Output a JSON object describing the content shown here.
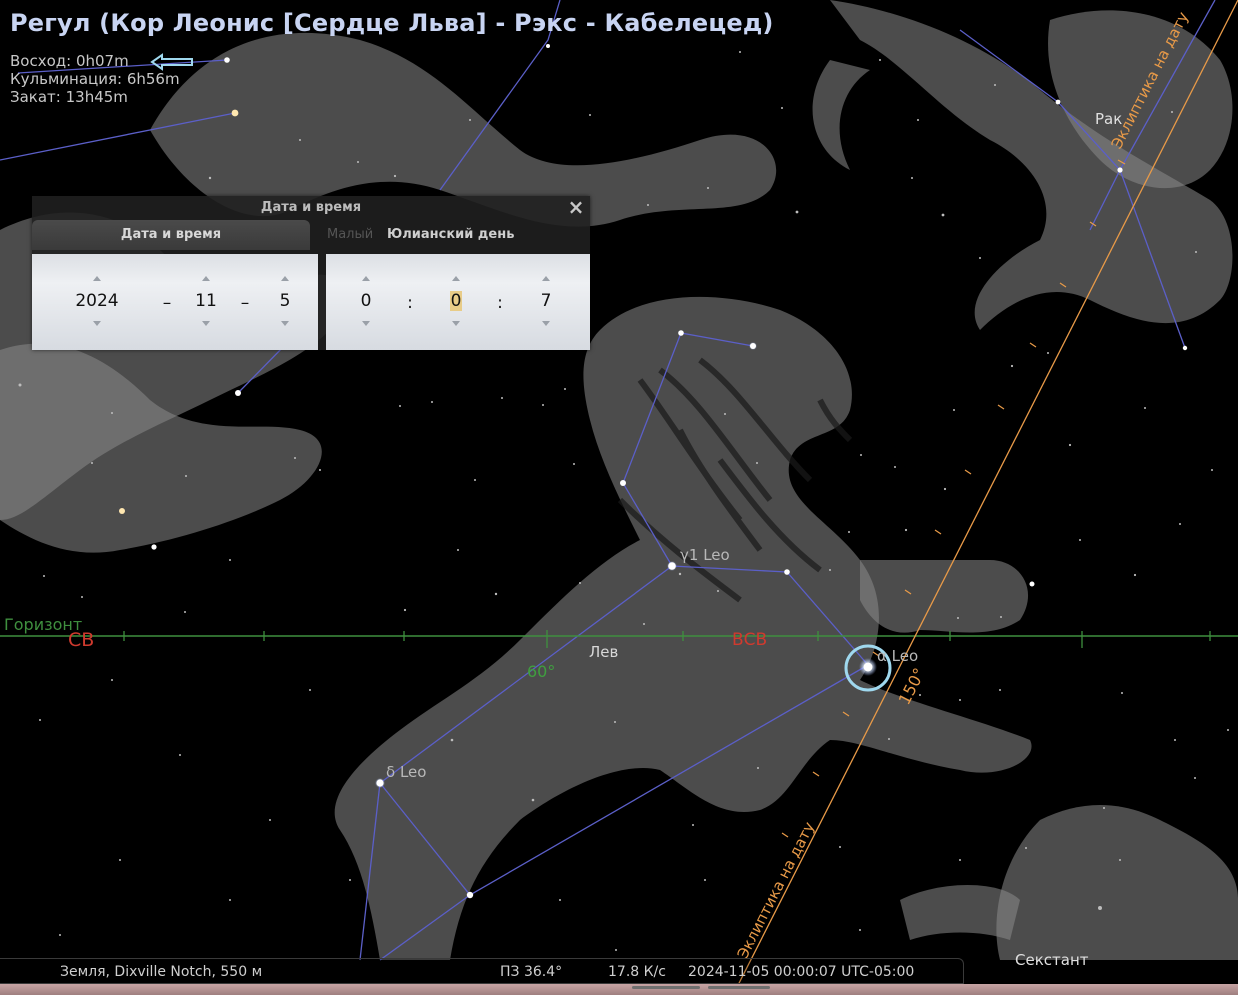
{
  "object": {
    "title": "Регул (Кор Леонис [Сердце Льва] - Рэкс - Кабелецед)",
    "rise": "Восход: 0h07m",
    "culmination": "Кульминация: 6h56m",
    "set": "Закат: 13h45m"
  },
  "sky": {
    "horizon_label": "Горизонт",
    "cardinal_ne": "СВ",
    "cardinal_ene": "ВСВ",
    "azimuth_60": "60°",
    "ecliptic_label": "Эклиптика на дату",
    "ecliptic_degree": "150°",
    "constellations": {
      "leo": "Лев",
      "cancer": "Рак",
      "sextant": "Секстант"
    },
    "stars": {
      "gamma_leo": "γ1 Leo",
      "delta_leo": "δ Leo",
      "alpha_leo": "α Leo"
    },
    "colors": {
      "horizon": "#3f8f3f",
      "cardinal": "#d03a2e",
      "ecliptic": "#e89a48",
      "constellation_lines": "#5b5fc8",
      "selection": "#9fd8ee"
    }
  },
  "dialog": {
    "title": "Дата и время",
    "close_icon": "close-icon",
    "tabs": {
      "date_time": "Дата и время",
      "faded": "Малый",
      "julian_day": "Юлианский день"
    },
    "date": {
      "year": "2024",
      "month": "11",
      "day": "5",
      "separator": "–"
    },
    "time": {
      "hour": "0",
      "minute": "0",
      "second": "7",
      "separator": ":"
    }
  },
  "status": {
    "location": "Земля, Dixville Notch, 550 м",
    "fov": "ПЗ 36.4°",
    "fps": "17.8 К/с",
    "datetime": "2024-11-05 00:00:07 UTC-05:00"
  }
}
